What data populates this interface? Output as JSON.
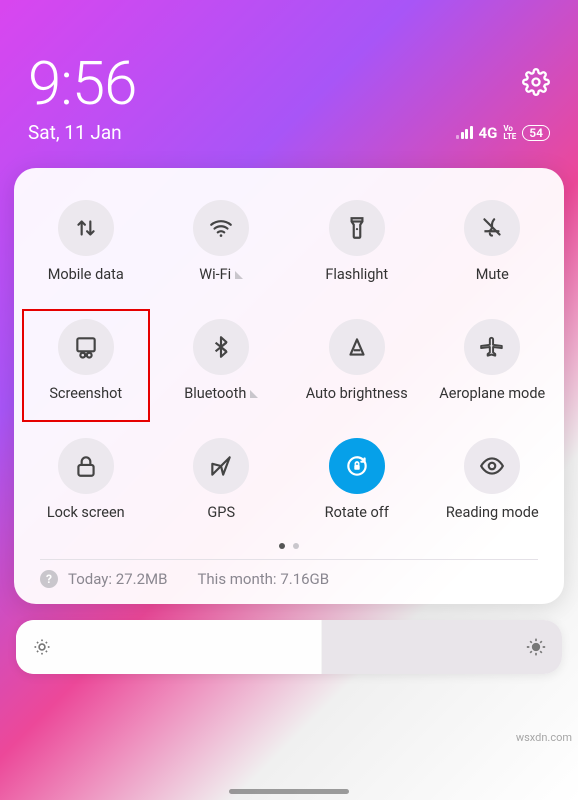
{
  "status": {
    "time": "9:56",
    "date": "Sat, 11 Jan",
    "network": "4G",
    "volte_top": "Vo",
    "volte_bottom": "LTE",
    "battery": "54"
  },
  "toggles": [
    {
      "id": "mobile-data",
      "label": "Mobile data",
      "icon": "mobile-data-icon",
      "expandable": false,
      "active": false
    },
    {
      "id": "wifi",
      "label": "Wi-Fi",
      "icon": "wifi-icon",
      "expandable": true,
      "active": false
    },
    {
      "id": "flashlight",
      "label": "Flashlight",
      "icon": "flashlight-icon",
      "expandable": false,
      "active": false
    },
    {
      "id": "mute",
      "label": "Mute",
      "icon": "mute-icon",
      "expandable": false,
      "active": false
    },
    {
      "id": "screenshot",
      "label": "Screenshot",
      "icon": "screenshot-icon",
      "expandable": false,
      "active": false,
      "highlighted": true
    },
    {
      "id": "bluetooth",
      "label": "Bluetooth",
      "icon": "bluetooth-icon",
      "expandable": true,
      "active": false
    },
    {
      "id": "auto-brightness",
      "label": "Auto brightness",
      "icon": "auto-brightness-icon",
      "expandable": false,
      "active": false
    },
    {
      "id": "aeroplane-mode",
      "label": "Aeroplane mode",
      "icon": "airplane-icon",
      "expandable": false,
      "active": false
    },
    {
      "id": "lock-screen",
      "label": "Lock screen",
      "icon": "lock-icon",
      "expandable": false,
      "active": false
    },
    {
      "id": "gps",
      "label": "GPS",
      "icon": "gps-icon",
      "expandable": false,
      "active": false
    },
    {
      "id": "rotate-off",
      "label": "Rotate off",
      "icon": "rotate-lock-icon",
      "expandable": false,
      "active": true
    },
    {
      "id": "reading-mode",
      "label": "Reading mode",
      "icon": "eye-icon",
      "expandable": false,
      "active": false
    }
  ],
  "usage": {
    "today_label": "Today:",
    "today_value": "27.2MB",
    "month_label": "This month:",
    "month_value": "7.16GB"
  },
  "watermark": "wsxdn.com"
}
